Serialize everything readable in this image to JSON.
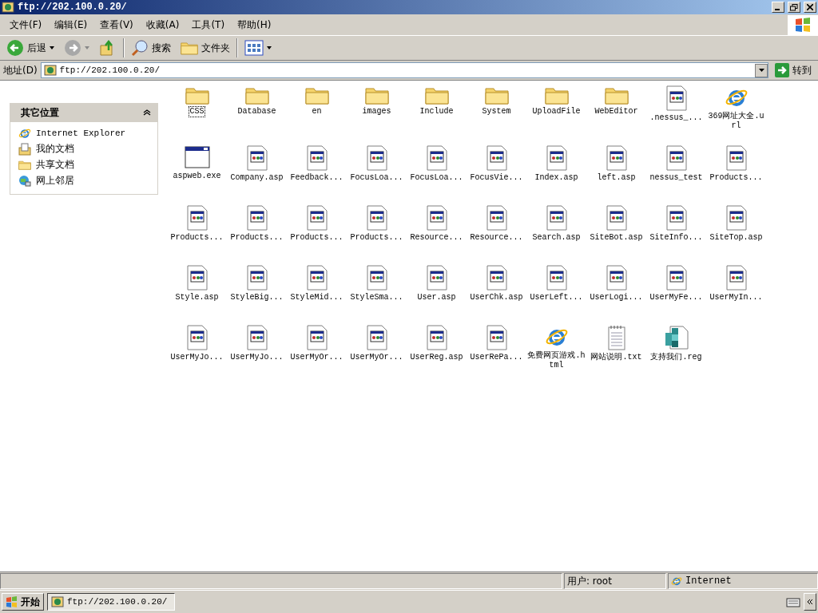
{
  "window": {
    "title": "ftp://202.100.0.20/"
  },
  "menu": [
    "文件(F)",
    "编辑(E)",
    "查看(V)",
    "收藏(A)",
    "工具(T)",
    "帮助(H)"
  ],
  "toolbar": {
    "back": "后退",
    "search": "搜索",
    "folders": "文件夹"
  },
  "address": {
    "label": "地址(D)",
    "value": "ftp://202.100.0.20/",
    "go": "转到"
  },
  "sidebar": {
    "title": "其它位置",
    "expanded": true,
    "items": [
      {
        "kind": "ie",
        "label": "Internet Explorer"
      },
      {
        "kind": "docs",
        "label": "我的文档"
      },
      {
        "kind": "folder",
        "label": "共享文档"
      },
      {
        "kind": "network",
        "label": "网上邻居"
      }
    ]
  },
  "files": [
    {
      "kind": "folder",
      "name": "CSS",
      "selected": true
    },
    {
      "kind": "folder",
      "name": "Database",
      "selected": false
    },
    {
      "kind": "folder",
      "name": "en",
      "selected": false
    },
    {
      "kind": "folder",
      "name": "images",
      "selected": false
    },
    {
      "kind": "folder",
      "name": "Include",
      "selected": false
    },
    {
      "kind": "folder",
      "name": "System",
      "selected": false
    },
    {
      "kind": "folder",
      "name": "UploadFile",
      "selected": false
    },
    {
      "kind": "folder",
      "name": "WebEditor",
      "selected": false
    },
    {
      "kind": "asp",
      "name": ".nessus_...",
      "selected": false
    },
    {
      "kind": "ie",
      "name": "369网址大全.url",
      "selected": false
    },
    {
      "kind": "exe",
      "name": "aspweb.exe",
      "selected": false
    },
    {
      "kind": "asp",
      "name": "Company.asp",
      "selected": false
    },
    {
      "kind": "asp",
      "name": "Feedback...",
      "selected": false
    },
    {
      "kind": "asp",
      "name": "FocusLoa...",
      "selected": false
    },
    {
      "kind": "asp",
      "name": "FocusLoa...",
      "selected": false
    },
    {
      "kind": "asp",
      "name": "FocusVie...",
      "selected": false
    },
    {
      "kind": "asp",
      "name": "Index.asp",
      "selected": false
    },
    {
      "kind": "asp",
      "name": "left.asp",
      "selected": false
    },
    {
      "kind": "asp",
      "name": "nessus_test",
      "selected": false
    },
    {
      "kind": "asp",
      "name": "Products...",
      "selected": false
    },
    {
      "kind": "asp",
      "name": "Products...",
      "selected": false
    },
    {
      "kind": "asp",
      "name": "Products...",
      "selected": false
    },
    {
      "kind": "asp",
      "name": "Products...",
      "selected": false
    },
    {
      "kind": "asp",
      "name": "Products...",
      "selected": false
    },
    {
      "kind": "asp",
      "name": "Resource...",
      "selected": false
    },
    {
      "kind": "asp",
      "name": "Resource...",
      "selected": false
    },
    {
      "kind": "asp",
      "name": "Search.asp",
      "selected": false
    },
    {
      "kind": "asp",
      "name": "SiteBot.asp",
      "selected": false
    },
    {
      "kind": "asp",
      "name": "SiteInfo...",
      "selected": false
    },
    {
      "kind": "asp",
      "name": "SiteTop.asp",
      "selected": false
    },
    {
      "kind": "asp",
      "name": "Style.asp",
      "selected": false
    },
    {
      "kind": "asp",
      "name": "StyleBig...",
      "selected": false
    },
    {
      "kind": "asp",
      "name": "StyleMid...",
      "selected": false
    },
    {
      "kind": "asp",
      "name": "StyleSma...",
      "selected": false
    },
    {
      "kind": "asp",
      "name": "User.asp",
      "selected": false
    },
    {
      "kind": "asp",
      "name": "UserChk.asp",
      "selected": false
    },
    {
      "kind": "asp",
      "name": "UserLeft...",
      "selected": false
    },
    {
      "kind": "asp",
      "name": "UserLogi...",
      "selected": false
    },
    {
      "kind": "asp",
      "name": "UserMyFe...",
      "selected": false
    },
    {
      "kind": "asp",
      "name": "UserMyIn...",
      "selected": false
    },
    {
      "kind": "asp",
      "name": "UserMyJo...",
      "selected": false
    },
    {
      "kind": "asp",
      "name": "UserMyJo...",
      "selected": false
    },
    {
      "kind": "asp",
      "name": "UserMyOr...",
      "selected": false
    },
    {
      "kind": "asp",
      "name": "UserMyOr...",
      "selected": false
    },
    {
      "kind": "asp",
      "name": "UserReg.asp",
      "selected": false
    },
    {
      "kind": "asp",
      "name": "UserRePa...",
      "selected": false
    },
    {
      "kind": "ie",
      "name": "免费网页游戏.html",
      "selected": false
    },
    {
      "kind": "txt",
      "name": "网站说明.txt",
      "selected": false
    },
    {
      "kind": "reg",
      "name": "支持我们.reg",
      "selected": false
    }
  ],
  "status_bar": {
    "pane_1": "用户: root",
    "zone": "Internet"
  },
  "taskbar": {
    "start": "开始",
    "task": "ftp://202.100.0.20/"
  }
}
